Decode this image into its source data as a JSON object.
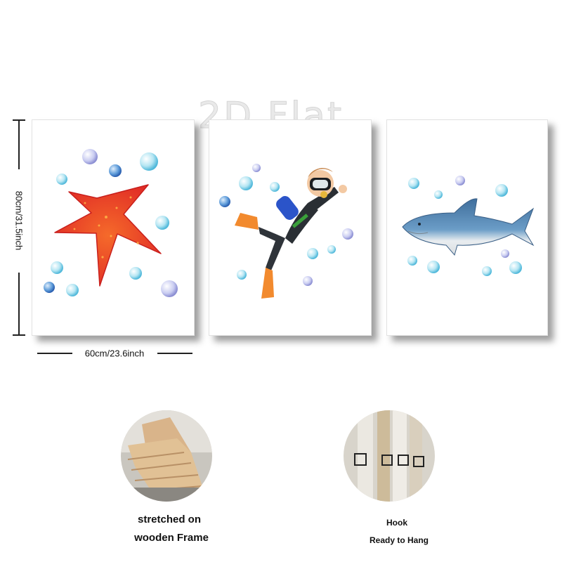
{
  "watermark": "2D Flat",
  "dimensions": {
    "height_label": "80cm/31.5inch",
    "width_label": "60cm/23.6inch"
  },
  "panels": [
    {
      "subject": "starfish",
      "accent": "#e8372b"
    },
    {
      "subject": "diver",
      "accent": "#2a2f34"
    },
    {
      "subject": "shark",
      "accent": "#4a7ca8"
    }
  ],
  "features": [
    {
      "subject": "wooden-frame-corner",
      "line1": "stretched on",
      "line2": "wooden Frame"
    },
    {
      "subject": "hook-detail",
      "line1": "Hook",
      "line2": "Ready to Hang"
    }
  ],
  "colors": {
    "bubble": "#7fd3e8",
    "bubble_deep": "#3f84c8",
    "bubble_violet": "#9a9ed8"
  }
}
